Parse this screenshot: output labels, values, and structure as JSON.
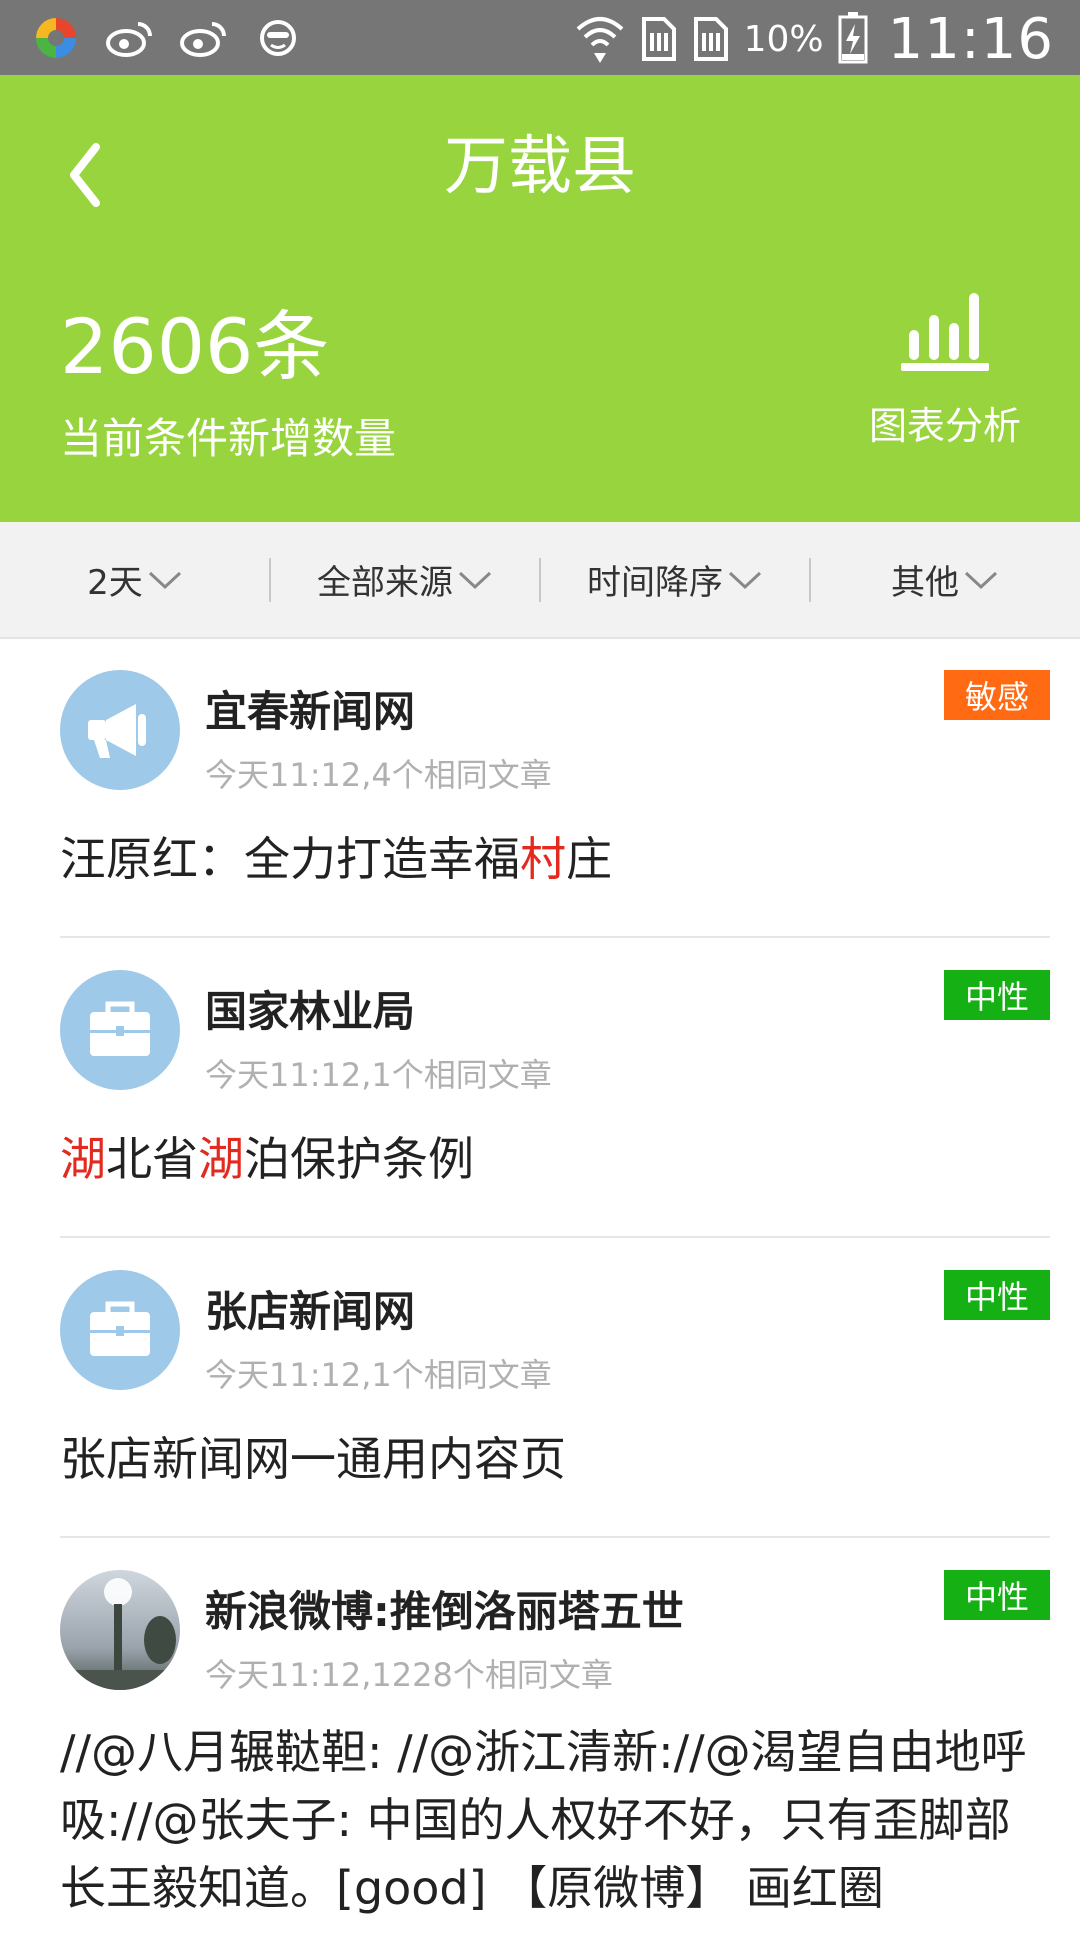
{
  "status_bar": {
    "battery_percent": "10%",
    "time": "11:16"
  },
  "header": {
    "title": "万载县",
    "count": "2606条",
    "count_label": "当前条件新增数量",
    "chart_label": "图表分析",
    "background_color": "#97d43e"
  },
  "filters": [
    {
      "label": "2天"
    },
    {
      "label": "全部来源"
    },
    {
      "label": "时间降序"
    },
    {
      "label": "其他"
    }
  ],
  "items": [
    {
      "source": "宜春新闻网",
      "meta": "今天11:12,4个相同文章",
      "badge": "敏感",
      "badge_color": "#ff6a13",
      "avatar_icon": "megaphone-icon",
      "headline_parts": [
        "汪原红：全力打造幸福",
        "村",
        "庄"
      ]
    },
    {
      "source": "国家林业局",
      "meta": "今天11:12,1个相同文章",
      "badge": "中性",
      "badge_color": "#14b014",
      "avatar_icon": "briefcase-icon",
      "headline_parts": [
        "",
        "湖",
        "北省",
        "湖",
        "泊保护条例"
      ]
    },
    {
      "source": "张店新闻网",
      "meta": "今天11:12,1个相同文章",
      "badge": "中性",
      "badge_color": "#14b014",
      "avatar_icon": "briefcase-icon",
      "headline": "张店新闻网一通用内容页"
    },
    {
      "source": "新浪微博:推倒洛丽塔五世",
      "meta": "今天11:12,1228个相同文章",
      "badge": "中性",
      "badge_color": "#14b014",
      "avatar_icon": "photo-avatar",
      "headline": "//@八月辗鞑靼: //@浙江清新://@渴望自由地呼吸://@张夫子: 中国的人权好不好，只有歪脚部长王毅知道。[good] 【原微博】 画红圈"
    }
  ]
}
